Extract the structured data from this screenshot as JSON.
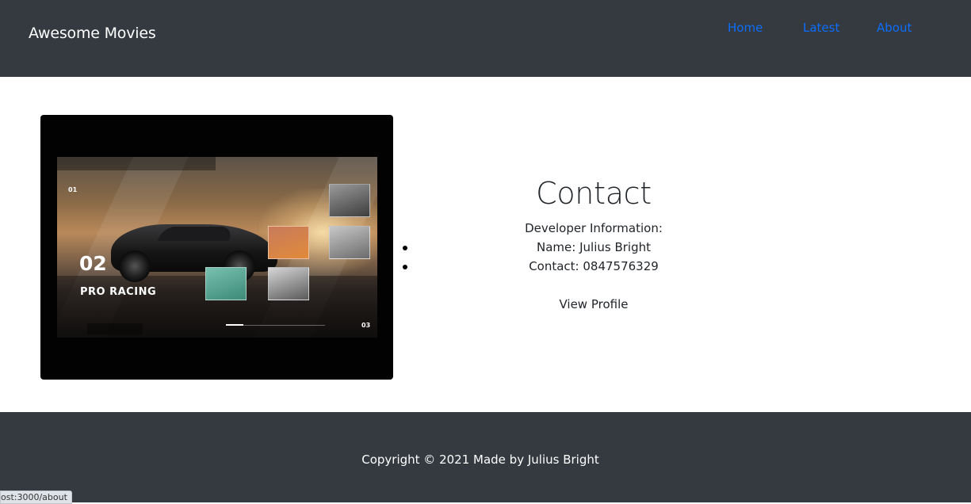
{
  "navbar": {
    "brand": "Awesome Movies",
    "links": [
      "Home",
      "Latest",
      "About"
    ],
    "link_color": "#0d6efd",
    "background": "#343a40"
  },
  "hero_image": {
    "slide_number": "02",
    "slide_title": "PRO RACING",
    "index_top": "01",
    "index_bottom": "03"
  },
  "contact": {
    "title": "Contact",
    "developer_label": "Developer Information:",
    "name": "Name: Julius Bright",
    "phone": "Contact: 0847576329",
    "profile_link": "View Profile"
  },
  "footer": {
    "copyright": "Copyright © 2021 Made by Julius Bright",
    "background": "#343a40"
  },
  "status_bar": {
    "url": "ost:3000/about"
  }
}
